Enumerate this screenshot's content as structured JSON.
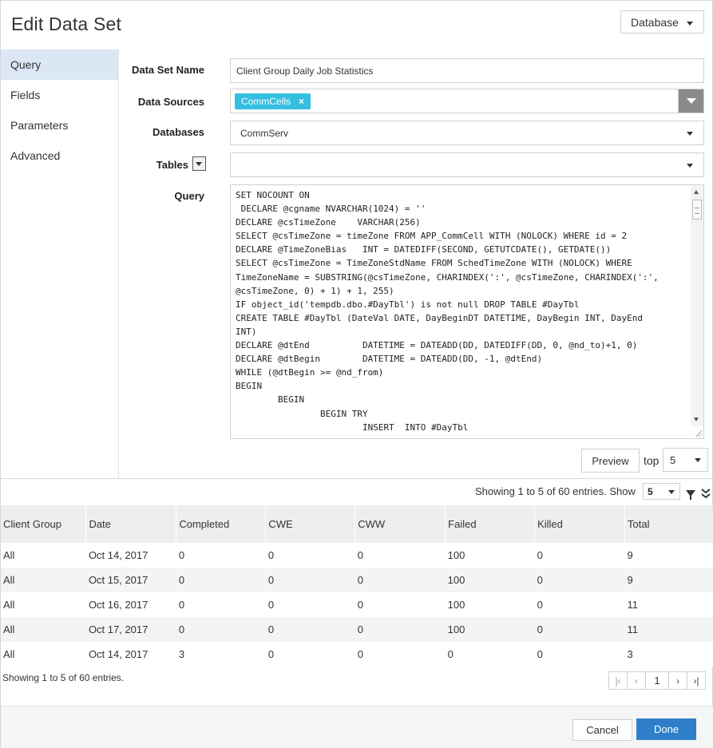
{
  "header": {
    "title": "Edit Data Set",
    "mode_select": "Database"
  },
  "nav": {
    "items": [
      {
        "label": "Query",
        "active": true
      },
      {
        "label": "Fields",
        "active": false
      },
      {
        "label": "Parameters",
        "active": false
      },
      {
        "label": "Advanced",
        "active": false
      }
    ]
  },
  "form": {
    "name_label": "Data Set Name",
    "name_value": "Client Group Daily Job Statistics",
    "sources_label": "Data Sources",
    "source_tag": "CommCells",
    "source_tag_remove": "×",
    "databases_label": "Databases",
    "databases_value": "CommServ",
    "tables_label": "Tables",
    "tables_value": "",
    "query_label": "Query",
    "query_text": "SET NOCOUNT ON\n DECLARE @cgname NVARCHAR(1024) = ''\nDECLARE @csTimeZone    VARCHAR(256)\nSELECT @csTimeZone = timeZone FROM APP_CommCell WITH (NOLOCK) WHERE id = 2\nDECLARE @TimeZoneBias   INT = DATEDIFF(SECOND, GETUTCDATE(), GETDATE())\nSELECT @csTimeZone = TimeZoneStdName FROM SchedTimeZone WITH (NOLOCK) WHERE\nTimeZoneName = SUBSTRING(@csTimeZone, CHARINDEX(':', @csTimeZone, CHARINDEX(':',\n@csTimeZone, 0) + 1) + 1, 255)\nIF object_id('tempdb.dbo.#DayTbl') is not null DROP TABLE #DayTbl\nCREATE TABLE #DayTbl (DateVal DATE, DayBeginDT DATETIME, DayBegin INT, DayEnd\nINT)\nDECLARE @dtEnd          DATETIME = DATEADD(DD, DATEDIFF(DD, 0, @nd_to)+1, 0)\nDECLARE @dtBegin        DATETIME = DATEADD(DD, -1, @dtEnd)\nWHILE (@dtBegin >= @nd_from)\nBEGIN\n        BEGIN\n                BEGIN TRY\n                        INSERT  INTO #DayTbl"
  },
  "preview": {
    "button_label": "Preview",
    "top_label": "top",
    "top_value": "5"
  },
  "grid": {
    "showing_text": "Showing 1 to 5 of 60 entries. Show",
    "show_value": "5",
    "columns": [
      "Client Group",
      "Date",
      "Completed",
      "CWE",
      "CWW",
      "Failed",
      "Killed",
      "Total"
    ],
    "rows": [
      [
        "All",
        "Oct 14, 2017",
        "0",
        "0",
        "0",
        "100",
        "0",
        "9"
      ],
      [
        "All",
        "Oct 15, 2017",
        "0",
        "0",
        "0",
        "100",
        "0",
        "9"
      ],
      [
        "All",
        "Oct 16, 2017",
        "0",
        "0",
        "0",
        "100",
        "0",
        "11"
      ],
      [
        "All",
        "Oct 17, 2017",
        "0",
        "0",
        "0",
        "100",
        "0",
        "11"
      ],
      [
        "All",
        "Oct 14, 2017",
        "3",
        "0",
        "0",
        "0",
        "0",
        "3"
      ]
    ],
    "showing_bottom": "Showing 1 to 5 of 60 entries.",
    "pager": {
      "first": "|‹",
      "prev": "‹",
      "page": "1",
      "next": "›",
      "last": "›|"
    }
  },
  "footer": {
    "cancel_label": "Cancel",
    "done_label": "Done"
  },
  "colors": {
    "accent": "#2f7fc8",
    "tag": "#35bfe0",
    "nav_active": "#dbe7f5"
  }
}
